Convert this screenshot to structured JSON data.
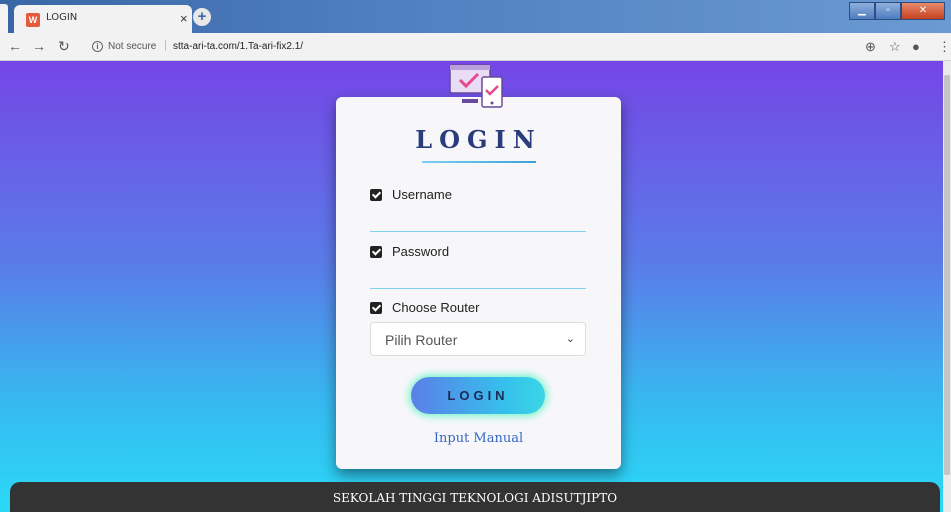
{
  "browser": {
    "tab_title": "LOGIN",
    "tab_favicon_text": "W",
    "new_tab_label": "+",
    "close_tab_label": "×",
    "security_text": "Not secure",
    "url": "stta-ari-ta.com/1.Ta-ari-fix2.1/"
  },
  "login": {
    "heading": "LOGIN",
    "username_label": "Username",
    "username_value": "",
    "password_label": "Password",
    "password_value": "",
    "router_label": "Choose Router",
    "router_selected": "Pilih Router",
    "submit_label": "LOGIN",
    "manual_link": "Input Manual"
  },
  "footer": {
    "text": "SEKOLAH TINGGI TEKNOLOGI ADISUTJIPTO"
  },
  "colors": {
    "gradient_top": "#7446e6",
    "gradient_bottom": "#2ad9f6",
    "heading": "#2b3c7c",
    "link": "#3568c4"
  }
}
